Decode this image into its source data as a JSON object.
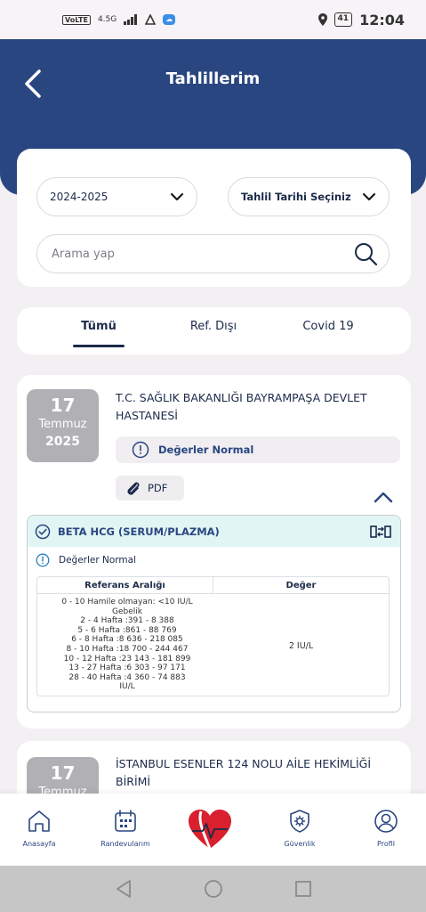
{
  "status_bar": {
    "volte": "VoLTE",
    "network": "4.5G",
    "battery": "41",
    "time": "12:04"
  },
  "header": {
    "title": "Tahlillerim"
  },
  "filters": {
    "year_select": "2024-2025",
    "date_select": "Tahlil Tarihi Seçiniz",
    "search_placeholder": "Arama yap"
  },
  "tabs": [
    {
      "label": "Tümü",
      "active": true
    },
    {
      "label": "Ref. Dışı",
      "active": false
    },
    {
      "label": "Covid 19",
      "active": false
    }
  ],
  "results": [
    {
      "day": "17",
      "month": "Temmuz",
      "year": "2025",
      "hospital": "T.C. SAĞLIK BAKANLIĞI BAYRAMPAŞA DEVLET HASTANESİ",
      "status": "Değerler Normal",
      "pdf_label": "PDF",
      "test": {
        "name": "BETA HCG (SERUM/PLAZMA)",
        "status": "Değerler Normal",
        "col_ref": "Referans Aralığı",
        "col_value": "Değer",
        "ref_lines": [
          "0 - 10 Hamile olmayan: <10 IU/L",
          "Gebelik",
          "2 - 4   Hafta :391 -  8 388",
          "5 - 6   Hafta :861  -  88 769",
          "6 - 8   Hafta :8 636 -  218 085",
          "8 - 10   Hafta :18 700 - 244 467",
          "10 - 12  Hafta :23 143 - 181 899",
          "13 - 27  Hafta :6 303 -  97 171",
          "28 - 40  Hafta :4 360 - 74 883",
          "IU/L"
        ],
        "value": "2 IU/L"
      }
    },
    {
      "day": "17",
      "month": "Temmuz",
      "hospital": "İSTANBUL ESENLER 124 NOLU AİLE HEKİMLİĞİ BİRİMİ"
    }
  ],
  "bottom_nav": [
    {
      "label": "Anasayfa",
      "icon": "home-icon"
    },
    {
      "label": "Randevularım",
      "icon": "calendar-icon"
    },
    {
      "label": "Güvenlik",
      "icon": "shield-gear-icon"
    },
    {
      "label": "Profil",
      "icon": "profile-icon"
    }
  ],
  "colors": {
    "primary": "#2a4680",
    "accent_light": "#e1f6f4",
    "date_box": "#b1b1b5",
    "background": "#f3f0f3"
  }
}
